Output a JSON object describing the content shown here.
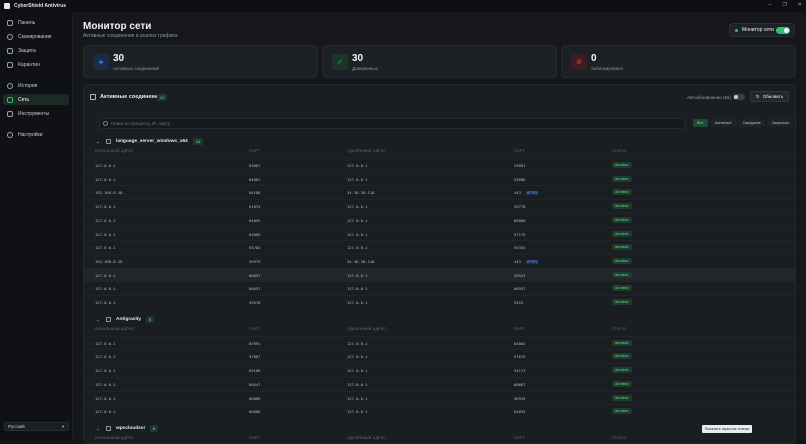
{
  "app": {
    "title": "CyberShield Antivirus"
  },
  "window_controls": {
    "minimize": "–",
    "maximize": "❐",
    "close": "✕"
  },
  "sidebar": {
    "items": [
      {
        "label": "Панель",
        "icon": "grid-icon",
        "active": false
      },
      {
        "label": "Сканирование",
        "icon": "scan-icon",
        "active": false
      },
      {
        "label": "Защита",
        "icon": "shield-icon",
        "active": false
      },
      {
        "label": "Карантин",
        "icon": "box-icon",
        "active": false
      },
      {
        "label": "История",
        "icon": "clock-icon",
        "active": false
      },
      {
        "label": "Сеть",
        "icon": "network-icon",
        "active": true
      },
      {
        "label": "Инструменты",
        "icon": "tools-icon",
        "active": false
      },
      {
        "label": "Настройки",
        "icon": "gear-icon",
        "active": false
      }
    ],
    "language": "Русский"
  },
  "header": {
    "title": "Монитор сети",
    "subtitle": "Активные соединения и анализ трафика",
    "monitor_toggle_label": "Монитор сети",
    "monitor_enabled": true
  },
  "stats": [
    {
      "value": "30",
      "label": "Активных соединений",
      "icon": "network-icon",
      "color": "#3b82f6"
    },
    {
      "value": "30",
      "label": "Доверенных",
      "icon": "check-icon",
      "color": "#2fbf71"
    },
    {
      "value": "0",
      "label": "Заблокировано",
      "icon": "blocked-icon",
      "color": "#ef4444"
    }
  ],
  "connections": {
    "title": "Активные соединения",
    "count": "30",
    "auto_refresh_label": "Автообновление (5s)",
    "auto_refresh_enabled": false,
    "refresh_label": "Обновить",
    "search_placeholder": "Поиск по процессу, IP, порту",
    "filters": [
      "Все",
      "Активные",
      "Ожидание",
      "Закрытые"
    ],
    "active_filter": "Все",
    "columns": [
      "ЛОКАЛЬНЫЙ АДРЕС",
      "ПОРТ",
      "УДАЛЁННЫЙ АДРЕС",
      "ПОРТ",
      "СТАТУС"
    ],
    "groups": [
      {
        "name": "language_server_windows_x64",
        "count": "11",
        "rows": [
          [
            "127.0.0.1",
            "63067",
            "127.0.0.1",
            "25891",
            "Активно",
            ""
          ],
          [
            "127.0.0.1",
            "64062",
            "127.0.0.1",
            "53686",
            "Активно",
            ""
          ],
          [
            "192.168.0.28",
            "64186",
            "34.36.28.118",
            "443",
            "Активно",
            "HTTPS"
          ],
          [
            "127.0.0.1",
            "61074",
            "127.0.0.1",
            "59778",
            "Активно",
            ""
          ],
          [
            "127.0.0.1",
            "64055",
            "127.0.0.1",
            "60066",
            "Активно",
            ""
          ],
          [
            "127.0.0.1",
            "63085",
            "127.0.0.1",
            "57175",
            "Активно",
            ""
          ],
          [
            "127.0.0.1",
            "63782",
            "127.0.0.1",
            "55353",
            "Активно",
            ""
          ],
          [
            "192.168.0.28",
            "59979",
            "34.36.28.118",
            "443",
            "Активно",
            "HTTPS"
          ],
          [
            "127.0.0.1",
            "60057",
            "127.0.0.1",
            "59523",
            "Активно",
            ""
          ],
          [
            "127.0.0.1",
            "60057",
            "127.0.0.1",
            "60557",
            "Активно",
            ""
          ],
          [
            "127.0.0.1",
            "59578",
            "127.0.0.1",
            "5522",
            "Активно",
            ""
          ]
        ]
      },
      {
        "name": "Antigravity",
        "count": "6",
        "rows": [
          [
            "127.0.0.1",
            "63991",
            "127.0.0.1",
            "64062",
            "Активно",
            ""
          ],
          [
            "127.0.0.1",
            "57887",
            "127.0.0.1",
            "57675",
            "Активно",
            ""
          ],
          [
            "127.0.0.1",
            "63108",
            "127.0.0.1",
            "54173",
            "Активно",
            ""
          ],
          [
            "127.0.0.1",
            "60547",
            "127.0.0.1",
            "60667",
            "Активно",
            ""
          ],
          [
            "127.0.0.1",
            "60066",
            "127.0.0.1",
            "56939",
            "Активно",
            ""
          ],
          [
            "127.0.0.1",
            "60066",
            "127.0.0.1",
            "64055",
            "Активно",
            ""
          ]
        ]
      },
      {
        "name": "wpscloudsvr",
        "count": "6",
        "rows": []
      }
    ]
  },
  "tooltip": "Показать скрытые значки",
  "colors": {
    "accent": "#2fbf71",
    "background": "#15171b"
  }
}
